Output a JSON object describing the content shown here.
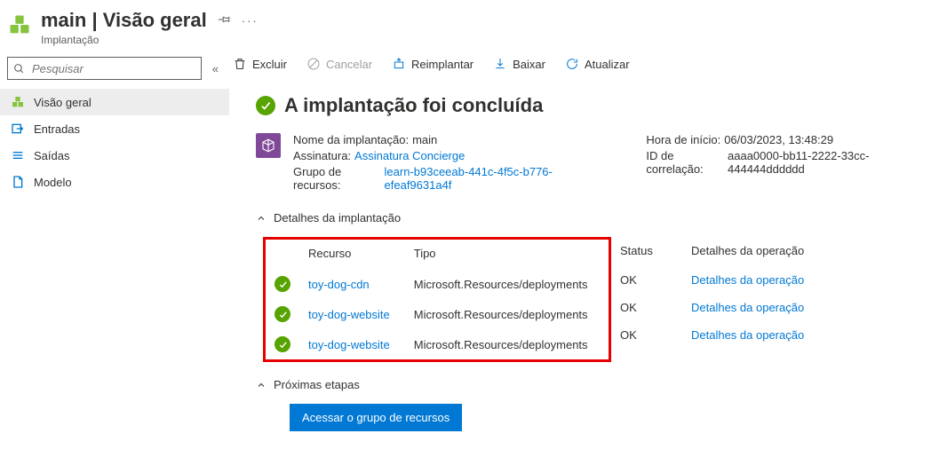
{
  "header": {
    "title": "main | Visão geral",
    "subtitle": "Implantação"
  },
  "search": {
    "placeholder": "Pesquisar"
  },
  "sidebar": {
    "items": [
      {
        "label": "Visão geral"
      },
      {
        "label": "Entradas"
      },
      {
        "label": "Saídas"
      },
      {
        "label": "Modelo"
      }
    ]
  },
  "toolbar": {
    "delete": "Excluir",
    "cancel": "Cancelar",
    "redeploy": "Reimplantar",
    "download": "Baixar",
    "refresh": "Atualizar"
  },
  "status_title": "A implantação foi concluída",
  "meta": {
    "deploy_name_label": "Nome da implantação:",
    "deploy_name": "main",
    "subscription_label": "Assinatura:",
    "subscription": "Assinatura Concierge",
    "rg_label": "Grupo de recursos:",
    "rg": "learn-b93ceeab-441c-4f5c-b776-efeaf9631a4f",
    "start_label": "Hora de início:",
    "start": "06/03/2023, 13:48:29",
    "corr_label": "ID de correlação:",
    "corr": "aaaa0000-bb11-2222-33cc-444444dddddd"
  },
  "details": {
    "heading": "Detalhes da implantação",
    "columns": {
      "resource": "Recurso",
      "type": "Tipo",
      "status": "Status",
      "op": "Detalhes da operação"
    },
    "rows": [
      {
        "resource": "toy-dog-cdn",
        "type": "Microsoft.Resources/deployments",
        "status": "OK",
        "op": "Detalhes da operação"
      },
      {
        "resource": "toy-dog-website",
        "type": "Microsoft.Resources/deployments",
        "status": "OK",
        "op": "Detalhes da operação"
      },
      {
        "resource": "toy-dog-website",
        "type": "Microsoft.Resources/deployments",
        "status": "OK",
        "op": "Detalhes da operação"
      }
    ]
  },
  "next": {
    "heading": "Próximas etapas",
    "button": "Acessar o grupo de recursos"
  }
}
